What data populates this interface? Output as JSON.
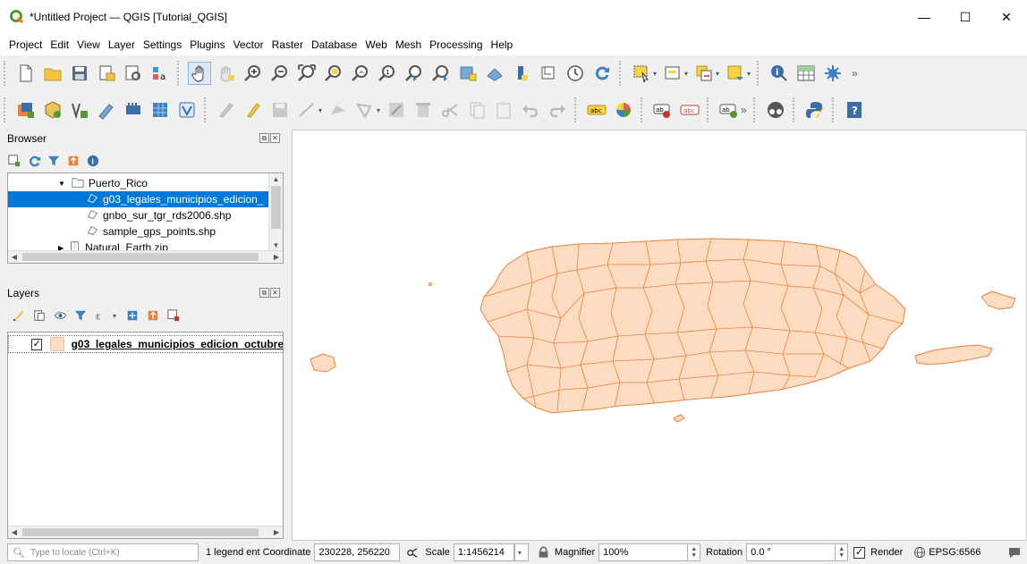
{
  "window": {
    "title": "*Untitled Project — QGIS [Tutorial_QGIS]",
    "minimize": "—",
    "maximize": "☐",
    "close": "✕"
  },
  "menu": [
    "Project",
    "Edit",
    "View",
    "Layer",
    "Settings",
    "Plugins",
    "Vector",
    "Raster",
    "Database",
    "Web",
    "Mesh",
    "Processing",
    "Help"
  ],
  "toolbar1": {
    "icons": [
      "new-project-icon",
      "open-project-icon",
      "save-project-icon",
      "new-print-layout-icon",
      "layout-manager-icon",
      "style-manager-icon",
      "pan-icon",
      "pan-to-selection-icon",
      "zoom-in-icon",
      "zoom-out-icon",
      "zoom-full-icon",
      "zoom-to-selection-icon",
      "zoom-to-layer-icon",
      "zoom-native-icon",
      "zoom-last-icon",
      "zoom-next-icon",
      "new-bookmark-icon",
      "show-bookmarks-icon",
      "new-map-view-icon",
      "new-3d-view-icon",
      "temporal-controller-icon",
      "refresh-icon",
      "select-features-icon",
      "deselect-icon",
      "select-by-value-icon",
      "select-location-icon",
      "identify-icon",
      "attribute-table-icon",
      "processing-toolbox-icon"
    ],
    "overflow": "»"
  },
  "toolbar2": {
    "icons": [
      "data-source-manager-icon",
      "new-geopackage-icon",
      "new-shapefile-icon",
      "digitize-icon",
      "add-delimited-text-icon",
      "add-raster-icon",
      "add-virtual-layer-icon",
      "current-edits-icon",
      "toggle-editing-icon",
      "save-edits-icon",
      "add-line-icon",
      "add-feature-icon",
      "vertex-tool-icon",
      "modify-attributes-icon",
      "delete-selected-icon",
      "cut-features-icon",
      "copy-features-icon",
      "paste-features-icon",
      "undo-icon",
      "redo-icon",
      "label-toolbar-icon",
      "diagram-icon",
      "pin-labels-icon",
      "show-hide-labels-icon",
      "move-label-icon",
      "georeferencer-icon",
      "python-console-icon",
      "help-icon"
    ],
    "overflow": "»"
  },
  "browser": {
    "title": "Browser",
    "items": [
      {
        "label": "Puerto_Rico",
        "type": "folder"
      },
      {
        "label": "g03_legales_municipios_edicion_",
        "type": "layer"
      },
      {
        "label": "gnbo_sur_tgr_rds2006.shp",
        "type": "layer"
      },
      {
        "label": "sample_gps_points.shp",
        "type": "layer"
      },
      {
        "label": "Natural_Earth.zip",
        "type": "zip"
      }
    ]
  },
  "layers": {
    "title": "Layers",
    "items": [
      {
        "label": "g03_legales_municipios_edicion_octubre",
        "checked": "✓",
        "fill": "#fddcc2"
      }
    ]
  },
  "map": {
    "fill": "#fddcc2",
    "stroke": "#e8823c"
  },
  "status": {
    "locate_placeholder": "Type to locate (Ctrl+K)",
    "legend_text": "1 legend ent",
    "coordinate_label": "Coordinate",
    "coordinate_value": "230228, 256220",
    "scale_label": "Scale",
    "scale_value": "1:1456214",
    "magnifier_label": "Magnifier",
    "magnifier_value": "100%",
    "rotation_label": "Rotation",
    "rotation_value": "0.0 °",
    "render_checked": "✓",
    "render_label": "Render",
    "crs": "EPSG:6566"
  }
}
